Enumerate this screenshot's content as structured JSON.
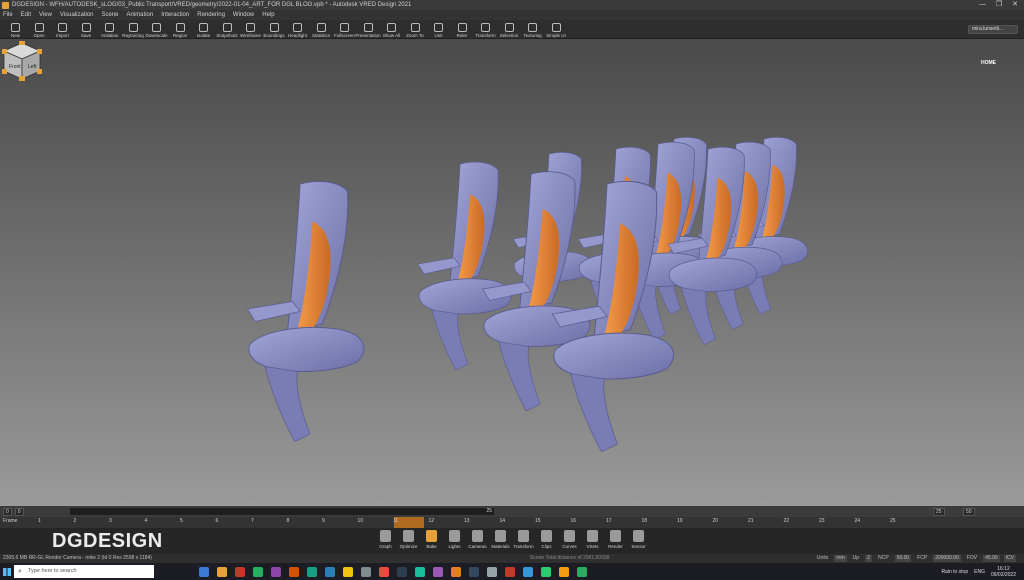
{
  "window": {
    "title": "DGDESIGN - WFH/AUTODESK_sLOG/03_Public Transport/VRED/geometry/2022-01-04_ART_FOR DGL BLOG.vpb * - Autodesk VRED Design 2021",
    "controls": [
      "—",
      "❐",
      "✕"
    ]
  },
  "menu": [
    "File",
    "Edit",
    "View",
    "Visualization",
    "Scene",
    "Animation",
    "Interaction",
    "Rendering",
    "Window",
    "Help"
  ],
  "toolbar": {
    "items": [
      "New",
      "Open",
      "Import",
      "Save",
      "Antialias",
      "Raytracing",
      "Downscale",
      "Region",
      "Isolate",
      "Snapshots",
      "Wireframe",
      "Boundings",
      "Headlight",
      "Statistics",
      "Fullscreen",
      "Presentation",
      "Show All",
      "Zoom To",
      "Unit",
      "Ruler",
      "Transform",
      "Selection",
      "Texturing",
      "Simple UI"
    ],
    "user": "mira.lunsetti..."
  },
  "viewport": {
    "navcube_home": "HOME",
    "navcube_faces": [
      "Front",
      "Left"
    ],
    "accent_color": "#e8a23a",
    "seat_shell_color": "#8c8fc4",
    "seat_cushion_color": "#e8863a"
  },
  "timeline": {
    "start": "0",
    "end": "25",
    "current": "0",
    "fps_a": "25",
    "fps_b": "50",
    "frame_label": "Frame",
    "ticks": [
      "1",
      "2",
      "3",
      "4",
      "5",
      "6",
      "7",
      "8",
      "9",
      "10",
      "11",
      "12",
      "13",
      "14",
      "15",
      "16",
      "17",
      "18",
      "19",
      "20",
      "21",
      "22",
      "23",
      "24",
      "25"
    ]
  },
  "brand": "DGDESIGN",
  "modules": [
    "Graph",
    "Optimize",
    "Bake",
    "Lights",
    "Cameras",
    "Materials",
    "Transform",
    "Clips",
    "Curves",
    "VSets",
    "Render",
    "Sensor"
  ],
  "status": {
    "left": "2305.6 MB RR-GL Render Camera - mike 2 (Id 0 Res 2598 x 1184)",
    "center": "Scene Total distance of 2981.00938",
    "units_label": "Units",
    "units": "mm",
    "up_label": "Up",
    "up": "Z",
    "ncp_label": "NCP",
    "ncp": "50.00",
    "fcp_label": "FCP",
    "fcp": "200000.00",
    "fov_label": "FOV",
    "fov": "45.00",
    "icv": "ICV"
  },
  "taskbar": {
    "search_placeholder": "Type here to search",
    "weather": "Rain to stop",
    "lang": "ENG",
    "time": "16:12",
    "date": "09/02/2022"
  }
}
